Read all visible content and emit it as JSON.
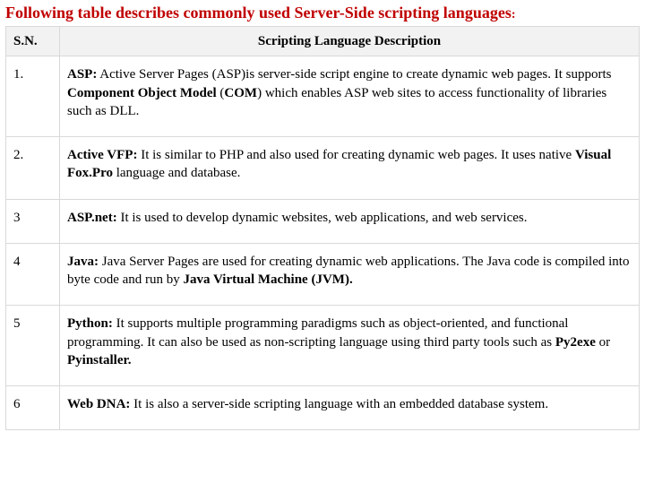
{
  "title_lead": "Following table describes commonly used Server-Side scripting languages",
  "title_colon": ":",
  "headers": {
    "sn": "S.N.",
    "desc": "Scripting Language Description"
  },
  "rows": [
    {
      "sn": "1.",
      "lead": "ASP:",
      "t1": " Active Server Pages (ASP)is server-side script engine to create dynamic web pages. It supports ",
      "b1": "Component Object Model",
      "t2": " (",
      "b2": "COM",
      "t3": ") which enables ASP web sites to access functionality of libraries such as DLL."
    },
    {
      "sn": "2.",
      "lead": "Active VFP:",
      "t1": " It is similar to PHP and also used for creating dynamic web pages. It uses native ",
      "b1": "Visual Fox.Pro",
      "t2": " language and database."
    },
    {
      "sn": "3",
      "lead": "ASP.net:",
      "t1": " It is used to develop dynamic websites, web applications, and web services."
    },
    {
      "sn": "4",
      "lead": "Java:",
      "t1": " Java Server Pages are used for creating dynamic web applications. The Java code is compiled into byte code and run by ",
      "b1": "Java Virtual Machine (JVM)."
    },
    {
      "sn": "5",
      "lead": "Python:",
      "t1": " It supports multiple programming paradigms such as object-oriented, and functional programming. It can also be used as non-scripting language using third party tools such as ",
      "b1": "Py2exe",
      "t2": " or ",
      "b2": "Pyinstaller."
    },
    {
      "sn": "6",
      "lead": "Web DNA:",
      "t1": " It is also a server-side scripting language with an embedded database system."
    }
  ]
}
